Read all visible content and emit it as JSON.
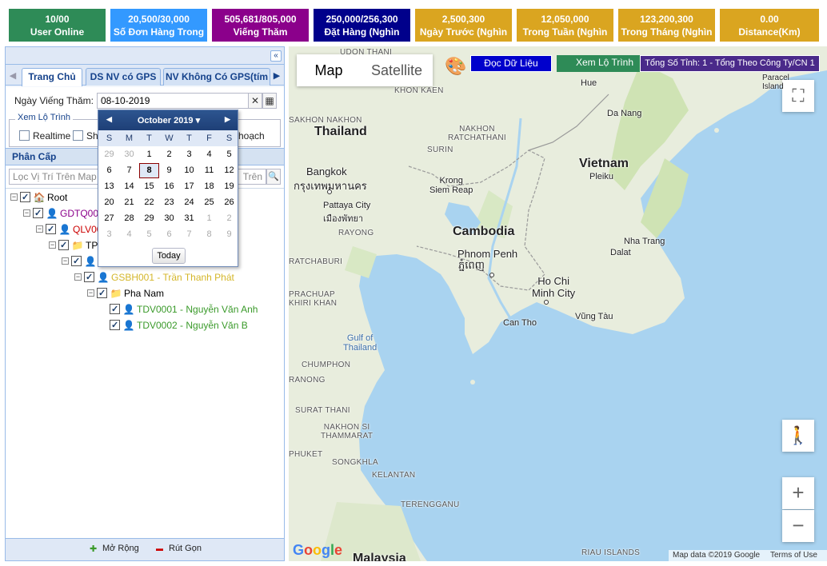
{
  "stats": [
    {
      "value": "10/00",
      "label": "User Online",
      "color": "#2e8b57"
    },
    {
      "value": "20,500/30,000",
      "label": "Số Đơn Hàng Trong",
      "color": "#3399ff"
    },
    {
      "value": "505,681/805,000",
      "label": "Viếng Thăm",
      "color": "#8b008b"
    },
    {
      "value": "250,000/256,300",
      "label": "Đặt Hàng (Nghìn",
      "color": "#00008b"
    },
    {
      "value": "2,500,300",
      "label": "Ngày Trước (Nghìn",
      "color": "#daa520"
    },
    {
      "value": "12,050,000",
      "label": "Trong Tuần (Nghìn",
      "color": "#daa520"
    },
    {
      "value": "123,200,300",
      "label": "Trong Tháng (Nghìn",
      "color": "#daa520"
    },
    {
      "value": "0.00",
      "label": "Distance(Km)",
      "color": "#daa520"
    }
  ],
  "left": {
    "collapse_icon": "«",
    "tab_prev": "◀",
    "tab_next": "▶",
    "tabs": [
      "Trang Chủ",
      "DS NV có GPS",
      "NV Không Có GPS(tím"
    ],
    "date_label": "Ngày Viếng Thăm:",
    "date_value": "08-10-2019",
    "clear_icon": "✕",
    "calendar_icon": "▦",
    "route_legend": "Xem Lộ Trình",
    "realtime": "Realtime",
    "sh_label": "Sh",
    "kehoach": "hoạch",
    "section": "Phân Cấp",
    "search_placeholder": "Lọc Vị Trí Trên Map",
    "search_placeholder2": "Trên ",
    "search_icon": "🔍",
    "tree": [
      {
        "exp": "−",
        "icon": "🏠",
        "text": "Root",
        "color": "#000"
      },
      {
        "exp": "−",
        "icon": "👤",
        "text": "GDTQ001",
        "color": "#8b008b"
      },
      {
        "exp": "−",
        "icon": "👤",
        "text": "QLV00",
        "color": "#cc0000"
      },
      {
        "exp": "−",
        "icon": "📁",
        "text": "TP",
        "color": "#000"
      },
      {
        "exp": "−",
        "icon": "👤",
        "text": "",
        "color": "#000"
      },
      {
        "exp": "−",
        "icon": "👤",
        "text": "GSBH001 - Trần Thanh Phát",
        "color": "#d4b62a"
      },
      {
        "exp": "−",
        "icon": "📁",
        "text": "Pha Nam",
        "color": "#000"
      },
      {
        "exp": "",
        "icon": "👤",
        "text": "TDV0001 - Nguyễn Văn Anh",
        "color": "#3a9a2a"
      },
      {
        "exp": "",
        "icon": "👤",
        "text": "TDV0002 - Nguyễn Văn B",
        "color": "#3a9a2a"
      }
    ],
    "expand_icon": "✚",
    "expand_label": "Mở Rộng",
    "collapse_icon2": "▬",
    "collapse_label": "Rút Gọn"
  },
  "calendar": {
    "month": "October 2019",
    "prev": "◀",
    "next": "▶",
    "dropdown": "▾",
    "dow": [
      "S",
      "M",
      "T",
      "W",
      "T",
      "F",
      "S"
    ],
    "weeks": [
      [
        "29",
        "30",
        "1",
        "2",
        "3",
        "4",
        "5"
      ],
      [
        "6",
        "7",
        "8",
        "9",
        "10",
        "11",
        "12"
      ],
      [
        "13",
        "14",
        "15",
        "16",
        "17",
        "18",
        "19"
      ],
      [
        "20",
        "21",
        "22",
        "23",
        "24",
        "25",
        "26"
      ],
      [
        "27",
        "28",
        "29",
        "30",
        "31",
        "1",
        "2"
      ],
      [
        "3",
        "4",
        "5",
        "6",
        "7",
        "8",
        "9"
      ]
    ],
    "today": "Today"
  },
  "map": {
    "map_btn": "Map",
    "satellite_btn": "Satellite",
    "palette_icon": "🎨",
    "read_data": "Đọc Dữ Liệu",
    "view_route": "Xem Lộ Trình",
    "total": "Tổng Số Tỉnh: 1 - Tổng Theo Công Ty/CN 1",
    "fullscreen_icon": "⛶",
    "pegman_icon": "🚶",
    "zoom_in": "+",
    "zoom_out": "−",
    "attribution": "Map data ©2019 Google",
    "terms": "Terms of Use",
    "logo": "Google",
    "labels": {
      "thailand": "Thailand",
      "cambodia": "Cambodia",
      "vietnam": "Vietnam",
      "bangkok": "Bangkok",
      "bangkok_th": "กรุงเทพมหานคร",
      "pattaya": "Pattaya City",
      "pattaya_th": "เมืองพัทยา",
      "siemreap": "Krong\nSiem Reap",
      "phnompenh": "Phnom Penh",
      "phnompenh_km": "ភ្នំពេញ",
      "hcm": "Ho Chi\nMinh City",
      "canto": "Can Tho",
      "vungtau": "Vũng Tàu",
      "hue": "Hue",
      "danang": "Da Nang",
      "pleiku": "Pleiku",
      "nhatrang": "Nha Trang",
      "dalat": "Dalat",
      "paracel": "Paracel\nIsland",
      "gulf": "Gulf of\nThailand",
      "udon": "UDON THANI",
      "khonkaen": "KHON KAEN",
      "sakhon": "SAKHON NAKHON",
      "nakhon": "NAKHON\nRATCHATHANI",
      "surin": "SURIN",
      "rayong": "RAYONG",
      "ratchaburi": "RATCHABURI",
      "chumphon": "CHUMPHON",
      "ranong": "RANONG",
      "surat": "SURAT THANI",
      "nakhonsi": "NAKHON SI\nTHAMMARAT",
      "phuket": "PHUKET",
      "songkhla": "SONGKHLA",
      "kelantan": "KELANTAN",
      "terengganu": "TERENGGANU",
      "riau": "RIAU ISLANDS",
      "prachuap": "PRACHUAP\nKHIRI KHAN",
      "malaysia": "Malaysia"
    }
  }
}
